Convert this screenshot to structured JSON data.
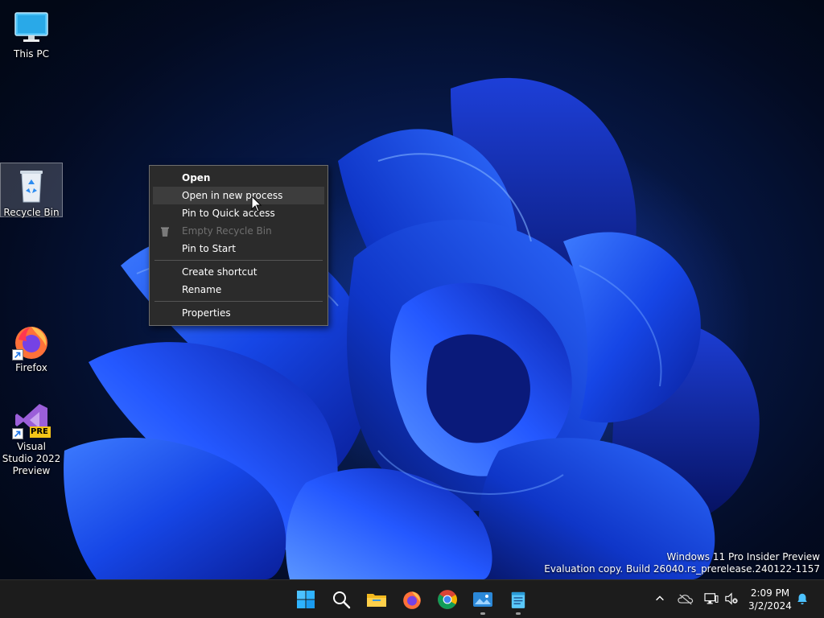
{
  "desktop": {
    "icons": [
      {
        "label": "This PC",
        "icon": "monitor-icon"
      },
      {
        "label": "Recycle Bin",
        "icon": "recycle-bin-icon"
      },
      {
        "label": "Firefox",
        "icon": "firefox-icon"
      },
      {
        "label": "Visual Studio 2022 Preview",
        "icon": "visual-studio-preview-icon",
        "badge": "PRE"
      }
    ]
  },
  "context_menu": {
    "items": [
      {
        "label": "Open",
        "bold": true
      },
      {
        "label": "Open in new process",
        "hovered": true
      },
      {
        "label": "Pin to Quick access"
      },
      {
        "label": "Empty Recycle Bin",
        "disabled": true,
        "icon": "recycle-bin-small-icon"
      },
      {
        "label": "Pin to Start"
      },
      {
        "label": "Create shortcut"
      },
      {
        "label": "Rename"
      },
      {
        "label": "Properties"
      }
    ]
  },
  "watermark": {
    "line1": "Windows 11 Pro Insider Preview",
    "line2": "Evaluation copy. Build 26040.rs_prerelease.240122-1157"
  },
  "taskbar": {
    "apps": [
      {
        "icon": "start-windows-icon"
      },
      {
        "icon": "search-icon"
      },
      {
        "icon": "file-explorer-icon"
      },
      {
        "icon": "firefox-icon"
      },
      {
        "icon": "chrome-icon"
      },
      {
        "icon": "photos-app-icon",
        "running": true
      },
      {
        "icon": "notepad-icon",
        "running": true
      }
    ],
    "tray": {
      "icons": [
        "chevron-up-icon",
        "onedrive-offline-icon",
        "network-icon",
        "speaker-muted-icon"
      ],
      "time": "2:09 PM",
      "date": "3/2/2024",
      "notification_icon": "bell-icon"
    }
  },
  "colors": {
    "menu_bg": "#2b2b2b",
    "menu_hover": "#3d3d3d",
    "taskbar_bg": "#1c1c1c",
    "wallpaper_blue": "#1a4dff"
  }
}
